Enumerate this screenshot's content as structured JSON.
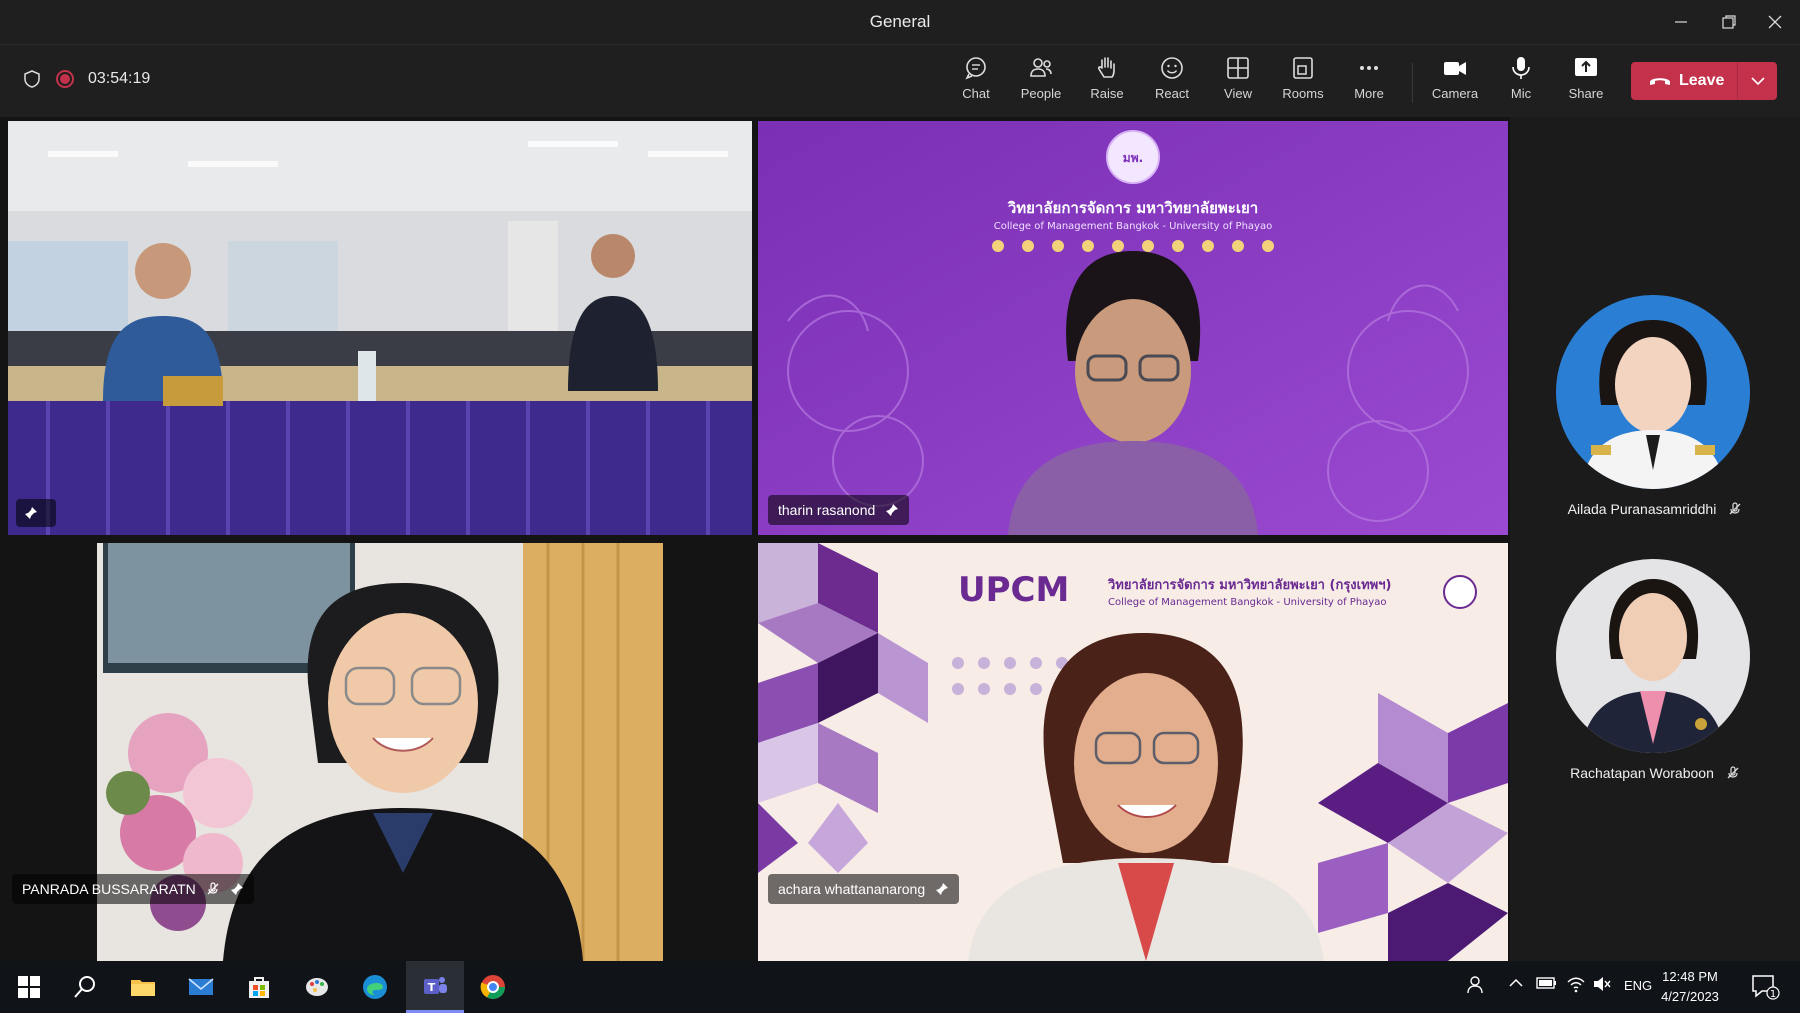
{
  "window": {
    "title": "General"
  },
  "meeting": {
    "duration": "03:54:19"
  },
  "toolbar": {
    "chat": "Chat",
    "people": "People",
    "raise": "Raise",
    "react": "React",
    "view": "View",
    "rooms": "Rooms",
    "more": "More",
    "camera": "Camera",
    "mic": "Mic",
    "share": "Share",
    "leave": "Leave"
  },
  "participants": {
    "tile_room": {
      "name": ""
    },
    "tile_tharin": {
      "name": "tharin rasanond"
    },
    "tile_panrada": {
      "name": "PANRADA BUSSARARATN"
    },
    "tile_achara": {
      "name": "achara whattananarong"
    },
    "side": [
      {
        "name": "Ailada Puranasamriddhi"
      },
      {
        "name": "Rachatapan Woraboon"
      }
    ]
  },
  "backgrounds": {
    "tharin_heading_th": "วิทยาลัยการจัดการ มหาวิทยาลัยพะเยา",
    "tharin_heading_en": "College of Management Bangkok - University of Phayao",
    "tharin_logo_text": "มพ.",
    "achara_brand": "UPCM",
    "achara_heading_th": "วิทยาลัยการจัดการ มหาวิทยาลัยพะเยา (กรุงเทพฯ)",
    "achara_heading_en": "College of Management Bangkok - University of Phayao"
  },
  "taskbar": {
    "language": "ENG",
    "time": "12:48 PM",
    "date": "4/27/2023",
    "notification_count": "1"
  },
  "colors": {
    "leave": "#c4314b",
    "accent": "#7f8bf5",
    "purple_bg": "#8a3cc4"
  }
}
